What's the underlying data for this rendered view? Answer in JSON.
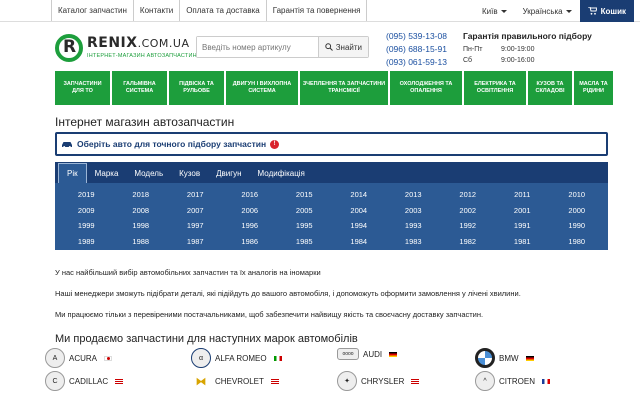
{
  "topnav": {
    "items": [
      "Каталог запчастин",
      "Контакти",
      "Оплата та доставка",
      "Гарантія та повернення"
    ],
    "city": "Київ",
    "language": "Українська",
    "cart_label": "Кошик"
  },
  "logo": {
    "name": "RENIX",
    "domain": ".COM.UA",
    "tagline": "ІНТЕРНЕТ-МАГАЗИН АВТОЗАПЧАСТИН"
  },
  "search": {
    "placeholder": "Введіть номер артикулу",
    "button_label": "Знайти"
  },
  "phones": [
    "(095) 539-13-08",
    "(096) 688-15-91",
    "(093) 061-59-13"
  ],
  "guarantee": {
    "title": "Гарантія правильного підбору",
    "rows": [
      {
        "days": "Пн-Пт",
        "hours": "9:00-19:00"
      },
      {
        "days": "Сб",
        "hours": "9:00-16:00"
      }
    ]
  },
  "menu": [
    "Запчастини для ТО",
    "Гальмівна система",
    "Підвіска та рульове",
    "Двигун і вихлопна система",
    "Зчеплення та запчастини трансмісії",
    "Охолодження та опалення",
    "Електрика та освітлення",
    "Кузов та складові",
    "Масла та рідини"
  ],
  "page_title": "Інтернет магазин автозапчастин",
  "picker": {
    "choose_label": "Оберіть авто для точного підбору запчастин",
    "tabs": [
      "Рік",
      "Марка",
      "Модель",
      "Кузов",
      "Двигун",
      "Модифікація"
    ],
    "active_tab": "Рік",
    "years": [
      "2019",
      "2018",
      "2017",
      "2016",
      "2015",
      "2014",
      "2013",
      "2012",
      "2011",
      "2010",
      "2009",
      "2008",
      "2007",
      "2006",
      "2005",
      "2004",
      "2003",
      "2002",
      "2001",
      "2000",
      "1999",
      "1998",
      "1997",
      "1996",
      "1995",
      "1994",
      "1993",
      "1992",
      "1991",
      "1990",
      "1989",
      "1988",
      "1987",
      "1986",
      "1985",
      "1984",
      "1983",
      "1982",
      "1981",
      "1980"
    ]
  },
  "paragraphs": [
    "У нас найбільший вибір автомобільних запчастин та їх аналогів на іномарки",
    "Наші менеджери зможуть підібрати деталі, які підійдуть до вашого автомобіля, і допоможуть оформити замовлення у лічені хвилини.",
    "Ми працюємо тільки з перевіреними постачальниками, щоб забезпечити найвищу якість та своєчасну доставку запчастин."
  ],
  "brands_title": "Ми продаємо запчастини для наступних марок автомобілів",
  "brands": [
    {
      "name": "ACURA",
      "icon": "acura-logo-icon",
      "flag": "jp"
    },
    {
      "name": "ALFA ROMEO",
      "icon": "alfa-romeo-logo-icon",
      "flag": "it"
    },
    {
      "name": "AUDI",
      "icon": "audi-logo-icon",
      "flag": "de"
    },
    {
      "name": "BMW",
      "icon": "bmw-logo-icon",
      "flag": "de"
    },
    {
      "name": "CADILLAC",
      "icon": "cadillac-logo-icon",
      "flag": "us"
    },
    {
      "name": "CHEVROLET",
      "icon": "chevrolet-logo-icon",
      "flag": "us"
    },
    {
      "name": "CHRYSLER",
      "icon": "chrysler-logo-icon",
      "flag": "us"
    },
    {
      "name": "CITROEN",
      "icon": "citroen-logo-icon",
      "flag": "fr"
    }
  ],
  "colors": {
    "brand_green": "#1d9e3c",
    "navy": "#1a3d73",
    "panel_blue": "#2c5a94",
    "link_blue": "#1a4fa0"
  }
}
